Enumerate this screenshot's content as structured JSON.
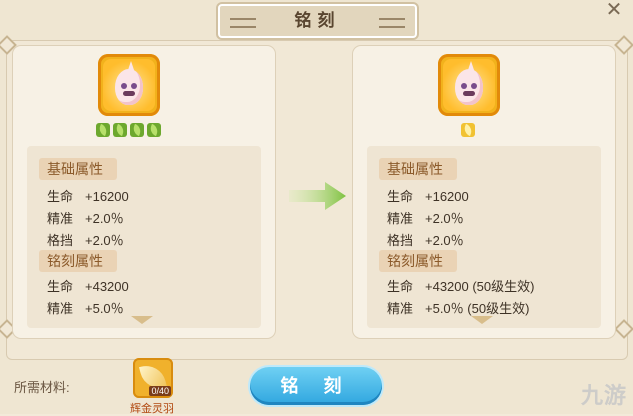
{
  "title": "铭刻",
  "left_panel": {
    "tabs": [
      "基础属性",
      "铭刻属性"
    ],
    "base_stats": [
      {
        "k": "生命",
        "v": "+16200"
      },
      {
        "k": "精准",
        "v": "+2.0％"
      },
      {
        "k": "格挡",
        "v": "+2.0％"
      }
    ],
    "engrave_stats": [
      {
        "k": "生命",
        "v": "+43200"
      },
      {
        "k": "精准",
        "v": "+5.0％"
      }
    ]
  },
  "right_panel": {
    "tabs": [
      "基础属性",
      "铭刻属性"
    ],
    "base_stats": [
      {
        "k": "生命",
        "v": "+16200"
      },
      {
        "k": "精准",
        "v": "+2.0％"
      },
      {
        "k": "格挡",
        "v": "+2.0％"
      }
    ],
    "engrave_stats": [
      {
        "k": "生命",
        "v": "+43200 (50级生效)"
      },
      {
        "k": "精准",
        "v": "+5.0％ (50级生效)"
      }
    ]
  },
  "materials": {
    "label": "所需材料:",
    "item_name": "辉金灵羽",
    "item_count": "0/40"
  },
  "action_button": "铭 刻",
  "watermark": "九游",
  "colors": {
    "accent_button": "#2fa6df",
    "leaf_green": "#6da82e",
    "leaf_gold": "#f1c232",
    "icon_gold": "#f2b21c"
  }
}
